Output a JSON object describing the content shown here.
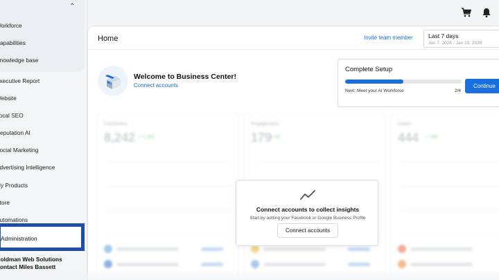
{
  "sidebar": {
    "items": [
      "Workforce",
      "Capabilities",
      "Knowledge base",
      "Executive Report",
      "Website",
      "Local SEO",
      "Reputation AI",
      "Social Marketing",
      "Advertising Intelligence",
      "My Products",
      "Store",
      "Automations"
    ],
    "admin_label": "Administration",
    "org_name": "Goldman Web Solutions",
    "contact_label": "Contact Miles Bassett"
  },
  "home": {
    "title": "Home",
    "invite_label": "Invite team member",
    "date_label": "Last 7 days",
    "date_range": "Jan 7, 2026 - Jan 13, 2026"
  },
  "welcome": {
    "title": "Welcome to Business Center!",
    "link": "Connect accounts"
  },
  "setup": {
    "title": "Complete Setup",
    "progress": 0.5,
    "next_step": "Next: Meet your AI Workforce",
    "count": "2/4",
    "button_label": "Continue"
  },
  "metrics": [
    {
      "label": "Customers",
      "value": "8,242",
      "delta": "+ 1,001"
    },
    {
      "label": "Engagement",
      "value": "179",
      "delta": "+ 18"
    },
    {
      "label": "Leads",
      "value": "444",
      "delta": "+ 100"
    }
  ],
  "overlay": {
    "title": "Connect accounts to collect insights",
    "subtitle": "Start by adding your Facebook or Google Business Profile",
    "button_label": "Connect accounts"
  },
  "colors": {
    "accent": "#1a6fe0",
    "admin_highlight": "#1d4fa8"
  }
}
